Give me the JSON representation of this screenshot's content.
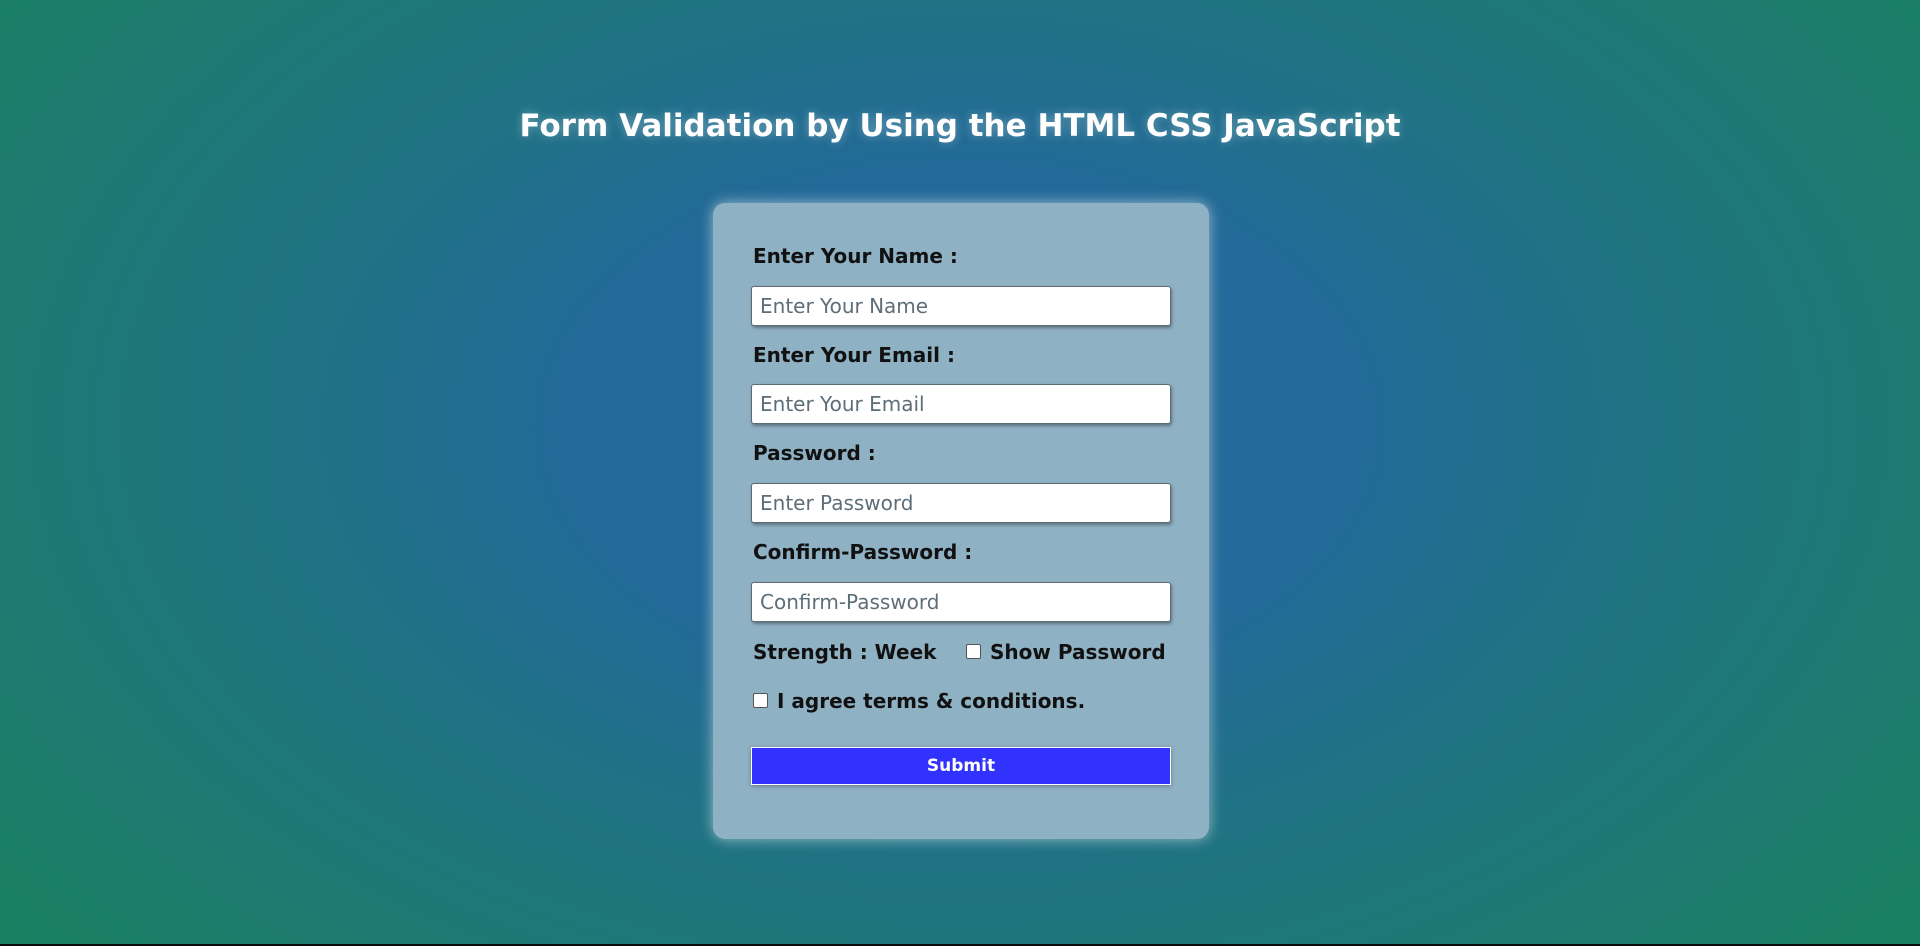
{
  "page": {
    "title": "Form Validation by Using the HTML CSS JavaScript"
  },
  "form": {
    "name": {
      "label": "Enter Your Name :",
      "placeholder": "Enter Your Name",
      "value": ""
    },
    "email": {
      "label": "Enter Your Email :",
      "placeholder": "Enter Your Email",
      "value": ""
    },
    "password": {
      "label": "Password :",
      "placeholder": "Enter Password",
      "value": ""
    },
    "confirm_password": {
      "label": "Confirm-Password :",
      "placeholder": "Confirm-Password",
      "value": ""
    },
    "strength_text": "Strength : Week",
    "show_password": {
      "label": "Show Password",
      "checked": false
    },
    "terms": {
      "label": "I agree terms & conditions.",
      "checked": false
    },
    "submit_label": "Submit"
  },
  "colors": {
    "submit_background": "#3232ff",
    "card_background": "#8fb1c4",
    "background_center": "#23699a",
    "background_edge": "#1a8060"
  }
}
